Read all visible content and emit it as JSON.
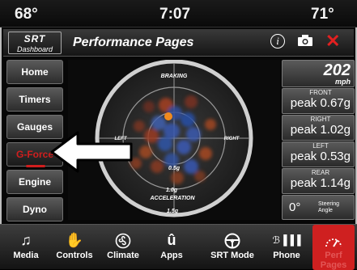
{
  "status": {
    "temp_left": "68°",
    "time": "7:07",
    "temp_right": "71°"
  },
  "header": {
    "logo_line1": "SRT",
    "logo_line2": "Dashboard",
    "title": "Performance Pages",
    "info_icon": "info-icon",
    "camera_icon": "camera-icon",
    "close_icon": "close-icon"
  },
  "menu": {
    "items": [
      {
        "label": "Home"
      },
      {
        "label": "Timers"
      },
      {
        "label": "Gauges"
      },
      {
        "label": "G-Force"
      },
      {
        "label": "Engine"
      },
      {
        "label": "Dyno"
      }
    ],
    "active_index": 3
  },
  "gauge": {
    "top_label": "BRAKING",
    "bottom_label": "ACCELERATION",
    "left_label": "LEFT",
    "right_label": "RIGHT",
    "ring_05": "0.5g",
    "ring_10": "1.0g",
    "ring_15": "1.5g"
  },
  "right": {
    "speed": "202",
    "speed_unit": "mph",
    "front_label": "FRONT",
    "front_value": "peak 0.67g",
    "right_label": "RIGHT",
    "right_value": "peak 1.02g",
    "left_label": "LEFT",
    "left_value": "peak 0.53g",
    "rear_label": "REAR",
    "rear_value": "peak 1.14g",
    "steering_value": "0°",
    "steering_label_1": "Steering",
    "steering_label_2": "Angle"
  },
  "nav": {
    "items": [
      {
        "label": "Media",
        "icon": "music-note-icon"
      },
      {
        "label": "Controls",
        "icon": "hand-icon"
      },
      {
        "label": "Climate",
        "icon": "fan-icon"
      },
      {
        "label": "Apps",
        "icon": "apps-icon"
      },
      {
        "label": "SRT Mode",
        "icon": "steering-wheel-icon"
      },
      {
        "label": "Phone",
        "icon": "phone-icon"
      },
      {
        "label": "Perf Pages",
        "icon": "performance-gauge-icon"
      }
    ],
    "active_index": 6
  },
  "colors": {
    "accent": "#d01e1e",
    "dot_current": "#f08a1e"
  }
}
